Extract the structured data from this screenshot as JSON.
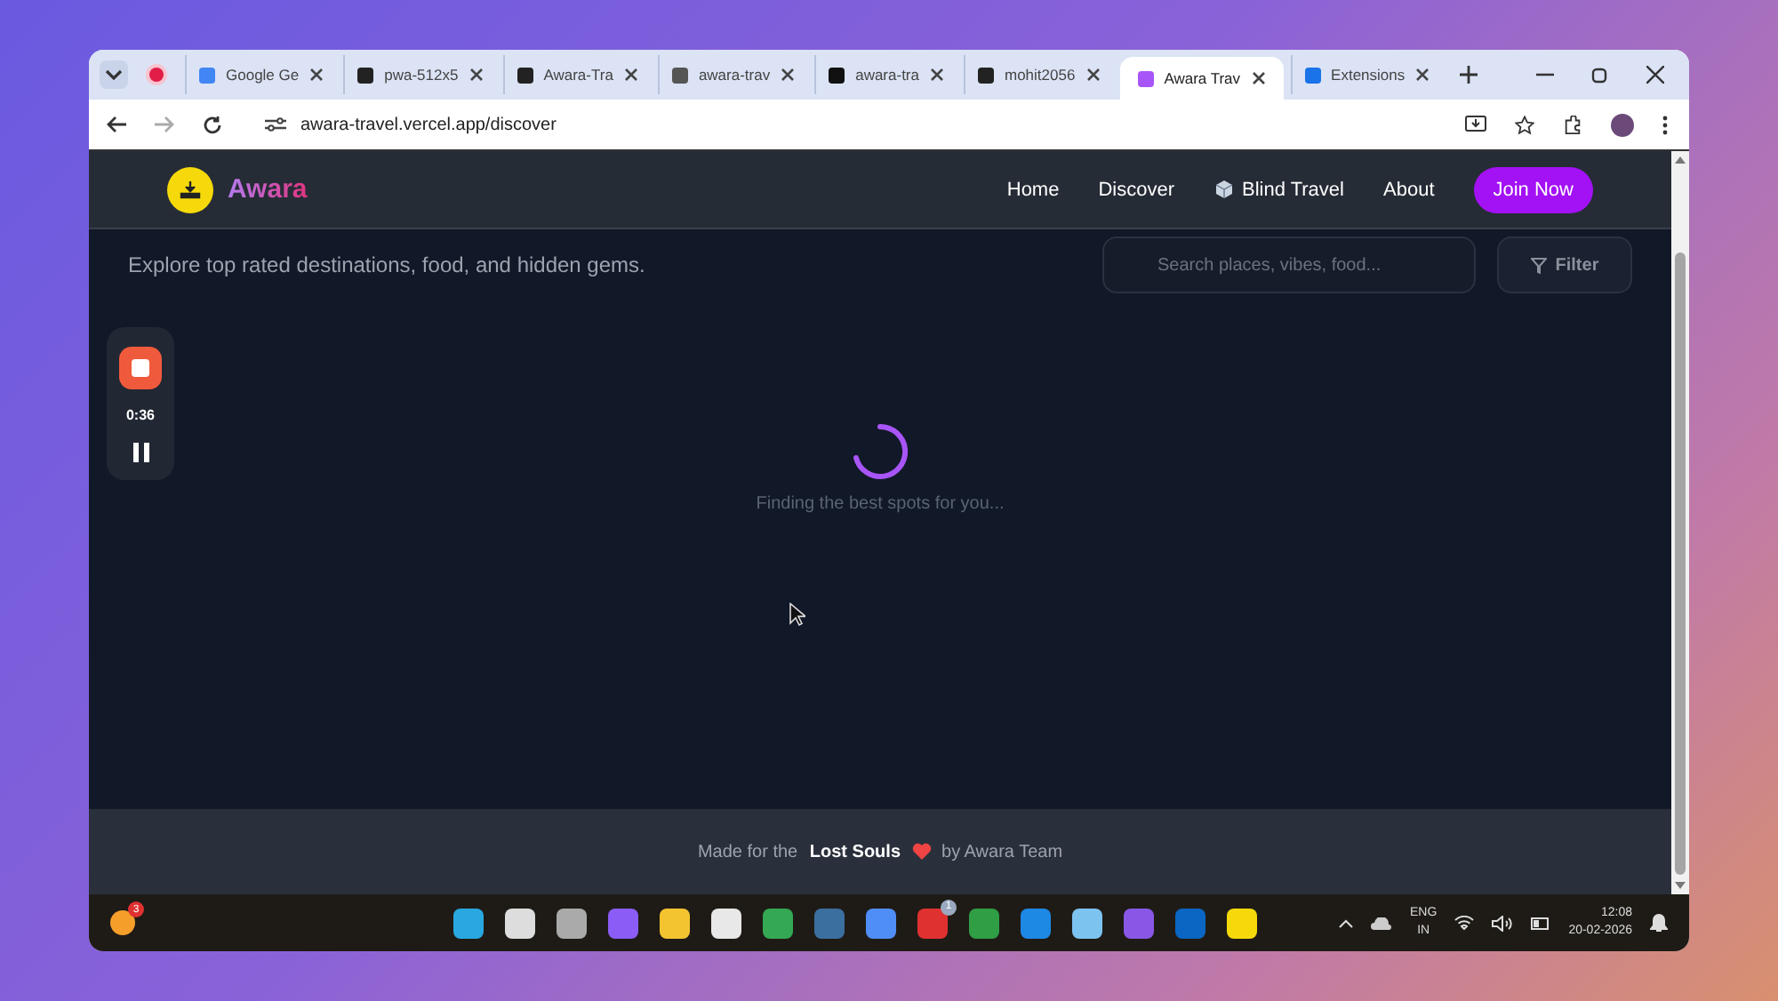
{
  "browser": {
    "tabs": [
      {
        "label": "Google Ge",
        "selected": false
      },
      {
        "label": "pwa-512x5",
        "selected": false
      },
      {
        "label": "Awara-Tra",
        "selected": false
      },
      {
        "label": "awara-trav",
        "selected": false
      },
      {
        "label": "awara-tra",
        "selected": false
      },
      {
        "label": "mohit2056",
        "selected": false
      },
      {
        "label": "Awara Trav",
        "selected": true
      },
      {
        "label": "Extensions",
        "selected": false
      }
    ],
    "address": "awara-travel.vercel.app/discover"
  },
  "page": {
    "brand": "Awara",
    "nav": [
      {
        "label": "Home",
        "kind": "link"
      },
      {
        "label": "Discover",
        "kind": "link"
      },
      {
        "label": "Blind Travel",
        "kind": "dice"
      },
      {
        "label": "About",
        "kind": "link"
      },
      {
        "label": "Join Now",
        "kind": "cta"
      }
    ],
    "subtitle": "Explore top rated destinations, food, and hidden gems.",
    "search": {
      "placeholder": "Search places, vibes, food..."
    },
    "filter": "Filter",
    "loading": "Finding the best spots for you...",
    "footer": {
      "before": "Made for the",
      "bold": "Lost Souls",
      "after": "by Awara Team"
    }
  },
  "recorder": {
    "time": "0:36"
  },
  "taskbar": {
    "start_badge": "3",
    "app_badge": "1",
    "lang": "ENG",
    "region": "IN",
    "time": "12:08",
    "date": "20-02-2026"
  }
}
